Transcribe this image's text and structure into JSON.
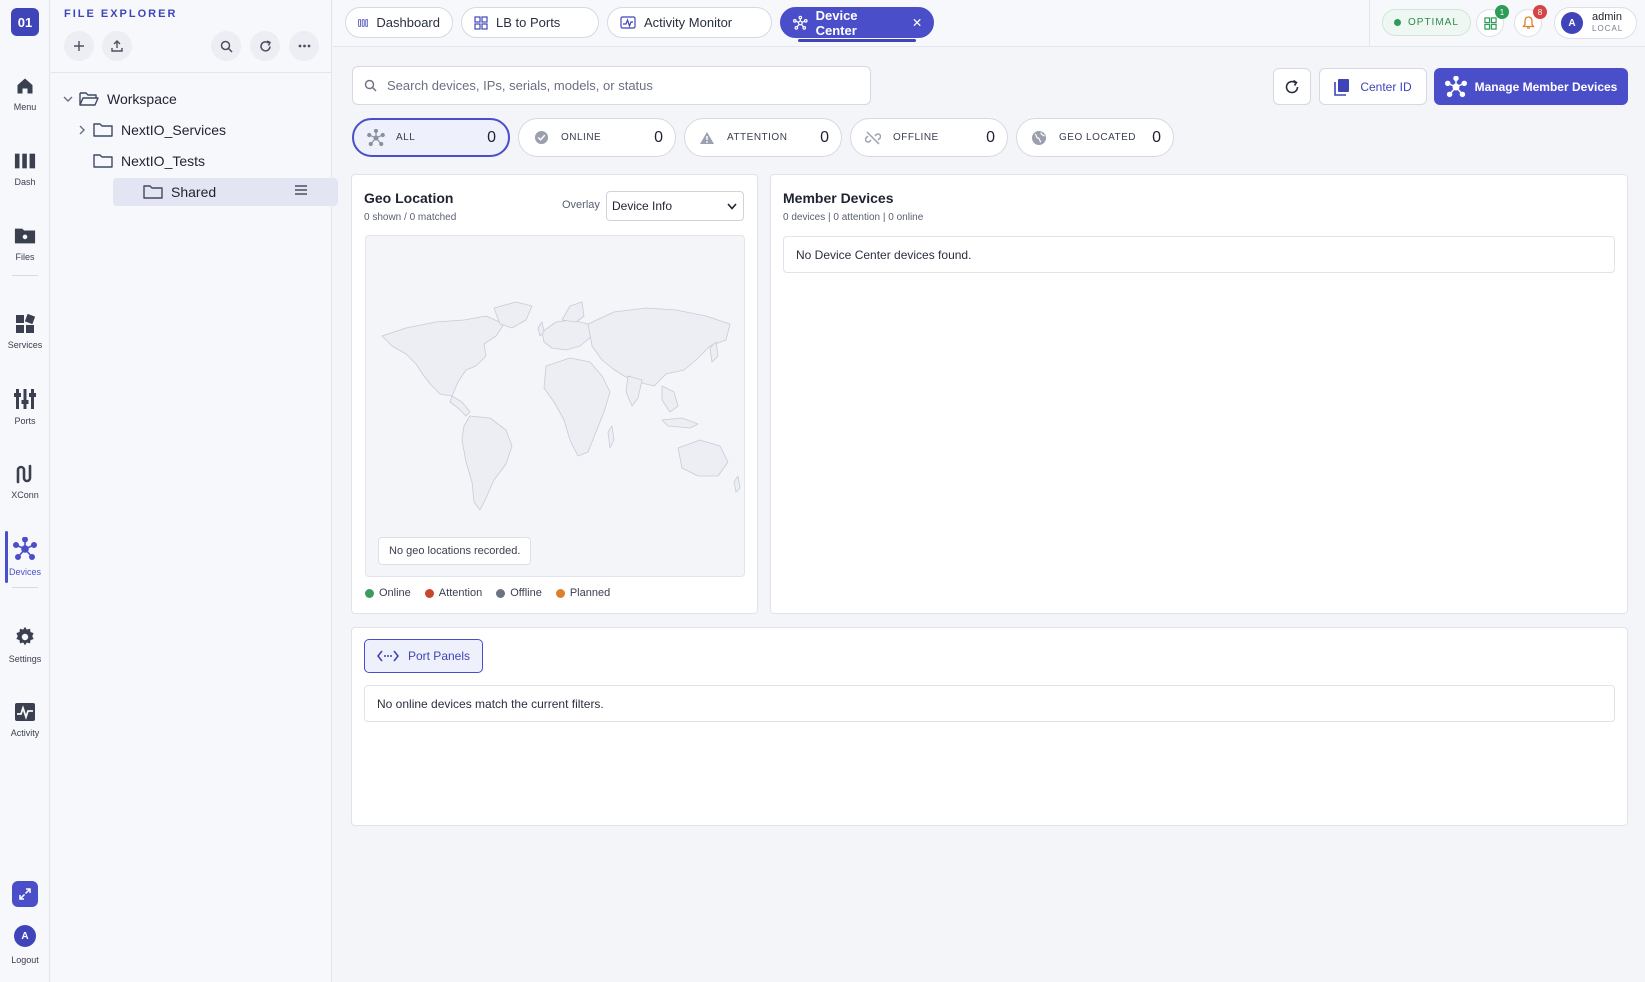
{
  "rail": {
    "logo": "01",
    "items": [
      {
        "label": "Menu",
        "icon": "home-icon"
      },
      {
        "label": "Dash",
        "icon": "dashboard-icon"
      },
      {
        "label": "Files",
        "icon": "folder-icon"
      },
      {
        "label": "Services",
        "icon": "services-icon"
      },
      {
        "label": "Ports",
        "icon": "ports-icon"
      },
      {
        "label": "XConn",
        "icon": "xconn-icon"
      },
      {
        "label": "Devices",
        "icon": "devices-icon"
      },
      {
        "label": "Settings",
        "icon": "gear-icon"
      },
      {
        "label": "Activity",
        "icon": "activity-icon"
      }
    ],
    "avatar": "A",
    "logout": "Logout"
  },
  "explorer": {
    "title": "FILE EXPLORER",
    "tree": [
      {
        "label": "Workspace",
        "level": 0,
        "expanded": true
      },
      {
        "label": "NextIO_Services",
        "level": 1,
        "expandable": true
      },
      {
        "label": "NextIO_Tests",
        "level": 1
      },
      {
        "label": "Shared",
        "level": 1,
        "selected": true
      }
    ]
  },
  "tabs": [
    {
      "label": "Dashboard"
    },
    {
      "label": "LB to Ports"
    },
    {
      "label": "Activity Monitor"
    },
    {
      "label": "Device Center",
      "active": true
    }
  ],
  "topbar": {
    "status": "OPTIMAL",
    "apps_badge": "1",
    "notif_badge": "8",
    "user_initial": "A",
    "user_name": "admin",
    "user_sub": "LOCAL"
  },
  "search": {
    "placeholder": "Search devices, IPs, serials, models, or status",
    "value": ""
  },
  "actions": {
    "center_id": "Center ID",
    "manage": "Manage Member Devices"
  },
  "filters": [
    {
      "label": "ALL",
      "count": "0",
      "icon": "devices-icon"
    },
    {
      "label": "ONLINE",
      "count": "0",
      "icon": "check-circle-icon"
    },
    {
      "label": "ATTENTION",
      "count": "0",
      "icon": "warning-icon"
    },
    {
      "label": "OFFLINE",
      "count": "0",
      "icon": "link-off-icon"
    },
    {
      "label": "GEO LOCATED",
      "count": "0",
      "icon": "globe-icon"
    }
  ],
  "geo": {
    "title": "Geo Location",
    "subtitle": "0 shown / 0 matched",
    "overlay_label": "Overlay",
    "overlay_value": "Device Info",
    "empty": "No geo locations recorded.",
    "legend": [
      {
        "label": "Online",
        "color": "#3e9b5f"
      },
      {
        "label": "Attention",
        "color": "#c8452e"
      },
      {
        "label": "Offline",
        "color": "#6b7280"
      },
      {
        "label": "Planned",
        "color": "#d9822b"
      }
    ]
  },
  "members": {
    "title": "Member Devices",
    "subtitle": "0 devices | 0 attention | 0 online",
    "empty": "No Device Center devices found."
  },
  "ports": {
    "button": "Port Panels",
    "empty": "No online devices match the current filters."
  },
  "colors": {
    "accent": "#4a4fc9",
    "accent_dark": "#3f45b8",
    "ok": "#2e9b57",
    "alert": "#d64545"
  }
}
